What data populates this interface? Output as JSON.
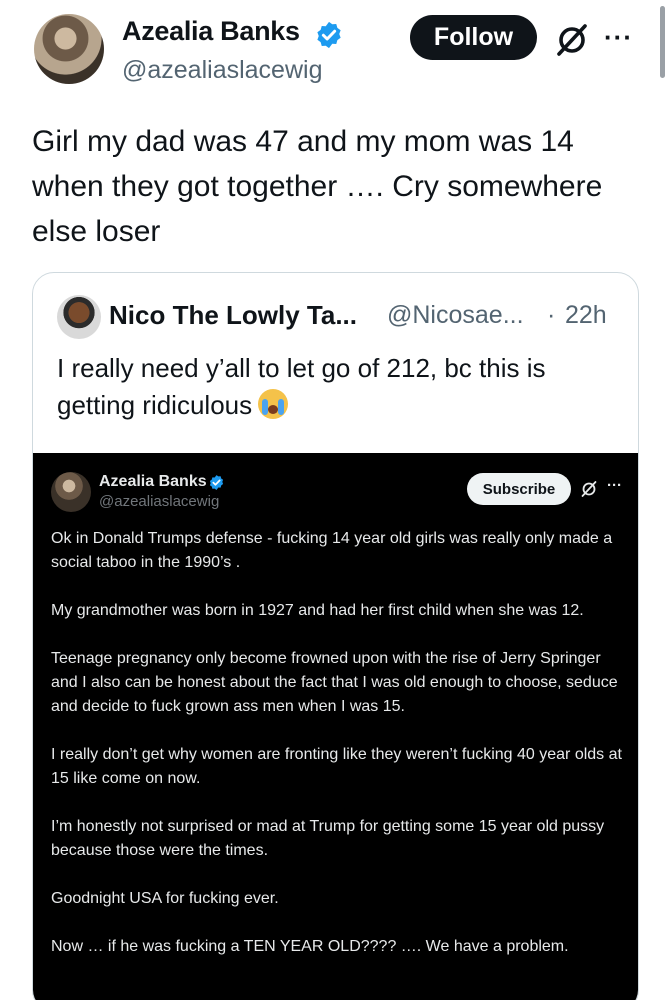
{
  "header": {
    "display_name": "Azealia Banks",
    "handle": "@azealiaslacewig",
    "follow_label": "Follow",
    "more_label": "···"
  },
  "tweet": {
    "text": "Girl my dad was 47 and my mom was 14 when they got together …. Cry somewhere else loser"
  },
  "quote": {
    "name": "Nico The Lowly Ta...",
    "handle": "@Nicosae...",
    "separator": "·",
    "time": "22h",
    "text": "I really need y’all to let go of 212, bc this is getting ridiculous",
    "media": {
      "name": "Azealia Banks",
      "handle": "@azealiaslacewig",
      "subscribe_label": "Subscribe",
      "more_label": "···",
      "paragraphs": [
        "Ok in Donald Trumps defense - fucking 14 year old girls was really only made a social taboo in the 1990’s .",
        "My grandmother was born in 1927 and had her first child when she was 12.",
        "Teenage pregnancy only become frowned upon with the rise of Jerry Springer and I also can be honest about the fact that I was old enough to choose, seduce and decide to fuck grown ass men when I was 15.",
        "I really don’t get why women are fronting like they weren’t fucking 40 year olds at 15 like come on now.",
        "I’m honestly not surprised or mad at Trump for getting some 15 year old pussy because those were the times.",
        "Goodnight USA for fucking ever.",
        "Now … if he was fucking a TEN YEAR OLD???? …. We have a problem."
      ]
    }
  },
  "colors": {
    "verified_blue": "#1d9bf0",
    "follow_bg": "#0f1419",
    "secondary_text": "#536471",
    "border": "#cfd9de"
  },
  "icons": {
    "verified": "verified-badge-icon",
    "grok": "grok-icon",
    "more": "more-icon",
    "emoji": "loudly-crying-face-emoji"
  }
}
